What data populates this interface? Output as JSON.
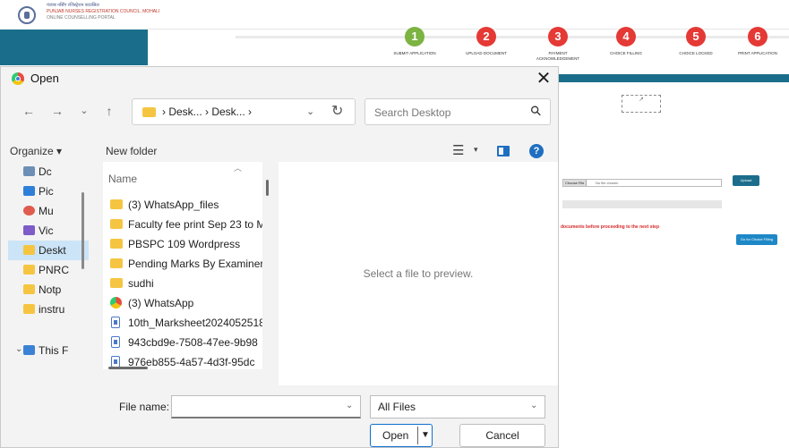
{
  "background_page": {
    "org_line1": "पंजाब नर्सिंग रजिस्ट्रेशन काउंसिल",
    "org_line2": "PUNJAB NURSES REGISTRATION COUNCIL, MOHALI",
    "org_line3": "ONLINE COUNSELLING PORTAL",
    "steps": [
      {
        "num": "1",
        "label": "SUBMIT APPLICATION",
        "color": "#7cb342"
      },
      {
        "num": "2",
        "label": "UPLOAD DOCUMENT",
        "color": "#e53935"
      },
      {
        "num": "3",
        "label": "PAYMENT ACKNOWLEDGEMENT",
        "color": "#e53935"
      },
      {
        "num": "4",
        "label": "CHOICE FILLING",
        "color": "#e53935"
      },
      {
        "num": "5",
        "label": "CHOICE LOCKED",
        "color": "#e53935"
      },
      {
        "num": "6",
        "label": "PRINT APPLICATION",
        "color": "#e53935"
      }
    ],
    "choose_file": "Choose File",
    "no_file": "No file chosen",
    "upload_label": "Upload",
    "warning": "documents before proceeding to the next step",
    "proceed_label": "Go for Choice Filling"
  },
  "dialog": {
    "title": "Open",
    "close": "✕",
    "nav": {
      "back": "←",
      "forward": "→",
      "recent": "⌄",
      "up": "↑"
    },
    "address_path": "›  Desk...  ›  Desk...  ›",
    "address_dropdown": "⌄",
    "refresh": "↻",
    "search_placeholder": "Search Desktop",
    "organize_label": "Organize ▾",
    "new_folder_label": "New folder",
    "view_label": "☰",
    "view_dropdown": "▾",
    "help_label": "?",
    "nav_items": [
      {
        "label": "Dc",
        "color": "#6d8fb5"
      },
      {
        "label": "Pic",
        "color": "#2f7fd8"
      },
      {
        "label": "Mu",
        "color": "#e05a4e"
      },
      {
        "label": "Vic",
        "color": "#7d5bc9"
      },
      {
        "label": "Deskt",
        "color": "#f5c542",
        "selected": true
      },
      {
        "label": "PNRC",
        "color": "#f5c542"
      },
      {
        "label": "Notp",
        "color": "#f5c542"
      },
      {
        "label": "instru",
        "color": "#f5c542"
      }
    ],
    "this_pc": "This F",
    "chevron": "⌄",
    "name_header": "Name",
    "sort_indicator": "︿",
    "files": [
      {
        "name": "(3) WhatsApp_files",
        "type": "folder"
      },
      {
        "name": "Faculty fee print Sep 23 to M",
        "type": "folder"
      },
      {
        "name": "PBSPC 109 Wordpress",
        "type": "folder"
      },
      {
        "name": "Pending Marks By Examiner",
        "type": "folder"
      },
      {
        "name": "sudhi",
        "type": "folder"
      },
      {
        "name": "(3) WhatsApp",
        "type": "chrome"
      },
      {
        "name": "10th_Marksheet2024052518",
        "type": "doc"
      },
      {
        "name": "943cbd9e-7508-47ee-9b98",
        "type": "doc"
      },
      {
        "name": "976eb855-4a57-4d3f-95dc",
        "type": "doc"
      }
    ],
    "preview_message": "Select a file to preview.",
    "file_name_label": "File name:",
    "file_name_value": "",
    "file_type": "All Files",
    "open_label": "Open",
    "cancel_label": "Cancel",
    "dropdown_glyph": "⌄",
    "split_arrow": "▼"
  }
}
